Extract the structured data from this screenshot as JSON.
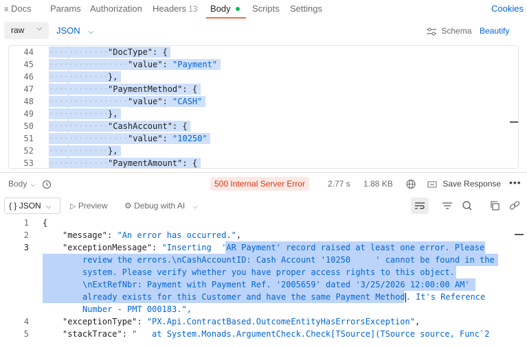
{
  "tabs": {
    "docs": "Docs",
    "params": "Params",
    "authorization": "Authorization",
    "headers": "Headers",
    "headers_count": "13",
    "body": "Body",
    "scripts": "Scripts",
    "settings": "Settings",
    "cookies": "Cookies"
  },
  "body_controls": {
    "raw": "raw",
    "json": "JSON",
    "schema": "Schema",
    "beautify": "Beautify"
  },
  "request_lines": [
    {
      "num": "44",
      "text": "\"DocType\": {"
    },
    {
      "num": "45",
      "key": "\"value\"",
      "val": "\"Payment\""
    },
    {
      "num": "46",
      "text": "},"
    },
    {
      "num": "47",
      "text": "\"PaymentMethod\": {"
    },
    {
      "num": "48",
      "key": "\"value\"",
      "val": "\"CASH\""
    },
    {
      "num": "49",
      "text": "},"
    },
    {
      "num": "50",
      "text": "\"CashAccount\": {"
    },
    {
      "num": "51",
      "key": "\"value\"",
      "val": "\"10250\""
    },
    {
      "num": "52",
      "text": "},"
    },
    {
      "num": "53",
      "text": "\"PaymentAmount\": {"
    }
  ],
  "response": {
    "body_label": "Body",
    "status": "500 Internal Server Error",
    "time": "2.77 s",
    "size": "1.88 KB",
    "save_response": "Save Response",
    "format": "JSON",
    "preview": "Preview",
    "debug": "Debug with AI",
    "lines": {
      "l1_num": "1",
      "l1": "{",
      "l2_num": "2",
      "l2_key": "\"message\"",
      "l2_val": "\"An error has occurred.\"",
      "l3_num": "3",
      "l3_key": "\"exceptionMessage\"",
      "l3_a": "\"Inserting  'AR Payment' record raised at least one error. Please",
      "l3_b": "review the errors.\\nCashAccountID: Cash Account '10250     ' cannot be found in the",
      "l3_c": "system. Please verify whether you have proper access rights to this object.",
      "l3_d": "\\nExtRefNbr: Payment with Payment Ref. '2005659' dated '3/25/2026 12:00:00 AM'",
      "l3_e1": "already exists for this Customer and have the same Payment Method",
      "l3_e2": ". It's Reference",
      "l3_f": "Number - PMT 000183.\",",
      "l4_num": "4",
      "l4_key": "\"exceptionType\"",
      "l4_val": "\"PX.Api.ContractBased.OutcomeEntityHasErrorsException\"",
      "l5_num": "5",
      "l5_key": "\"stackTrace\"",
      "l5_val": "\"   at System.Monads.ArgumentCheck.Check[TSource](TSource source, Func`2"
    }
  },
  "colors": {
    "accent": "#0265d2",
    "error": "#d0371a",
    "selection": "#bcd4fa",
    "active_dot": "#0cbb52",
    "tab_underline": "#f26b3a"
  }
}
